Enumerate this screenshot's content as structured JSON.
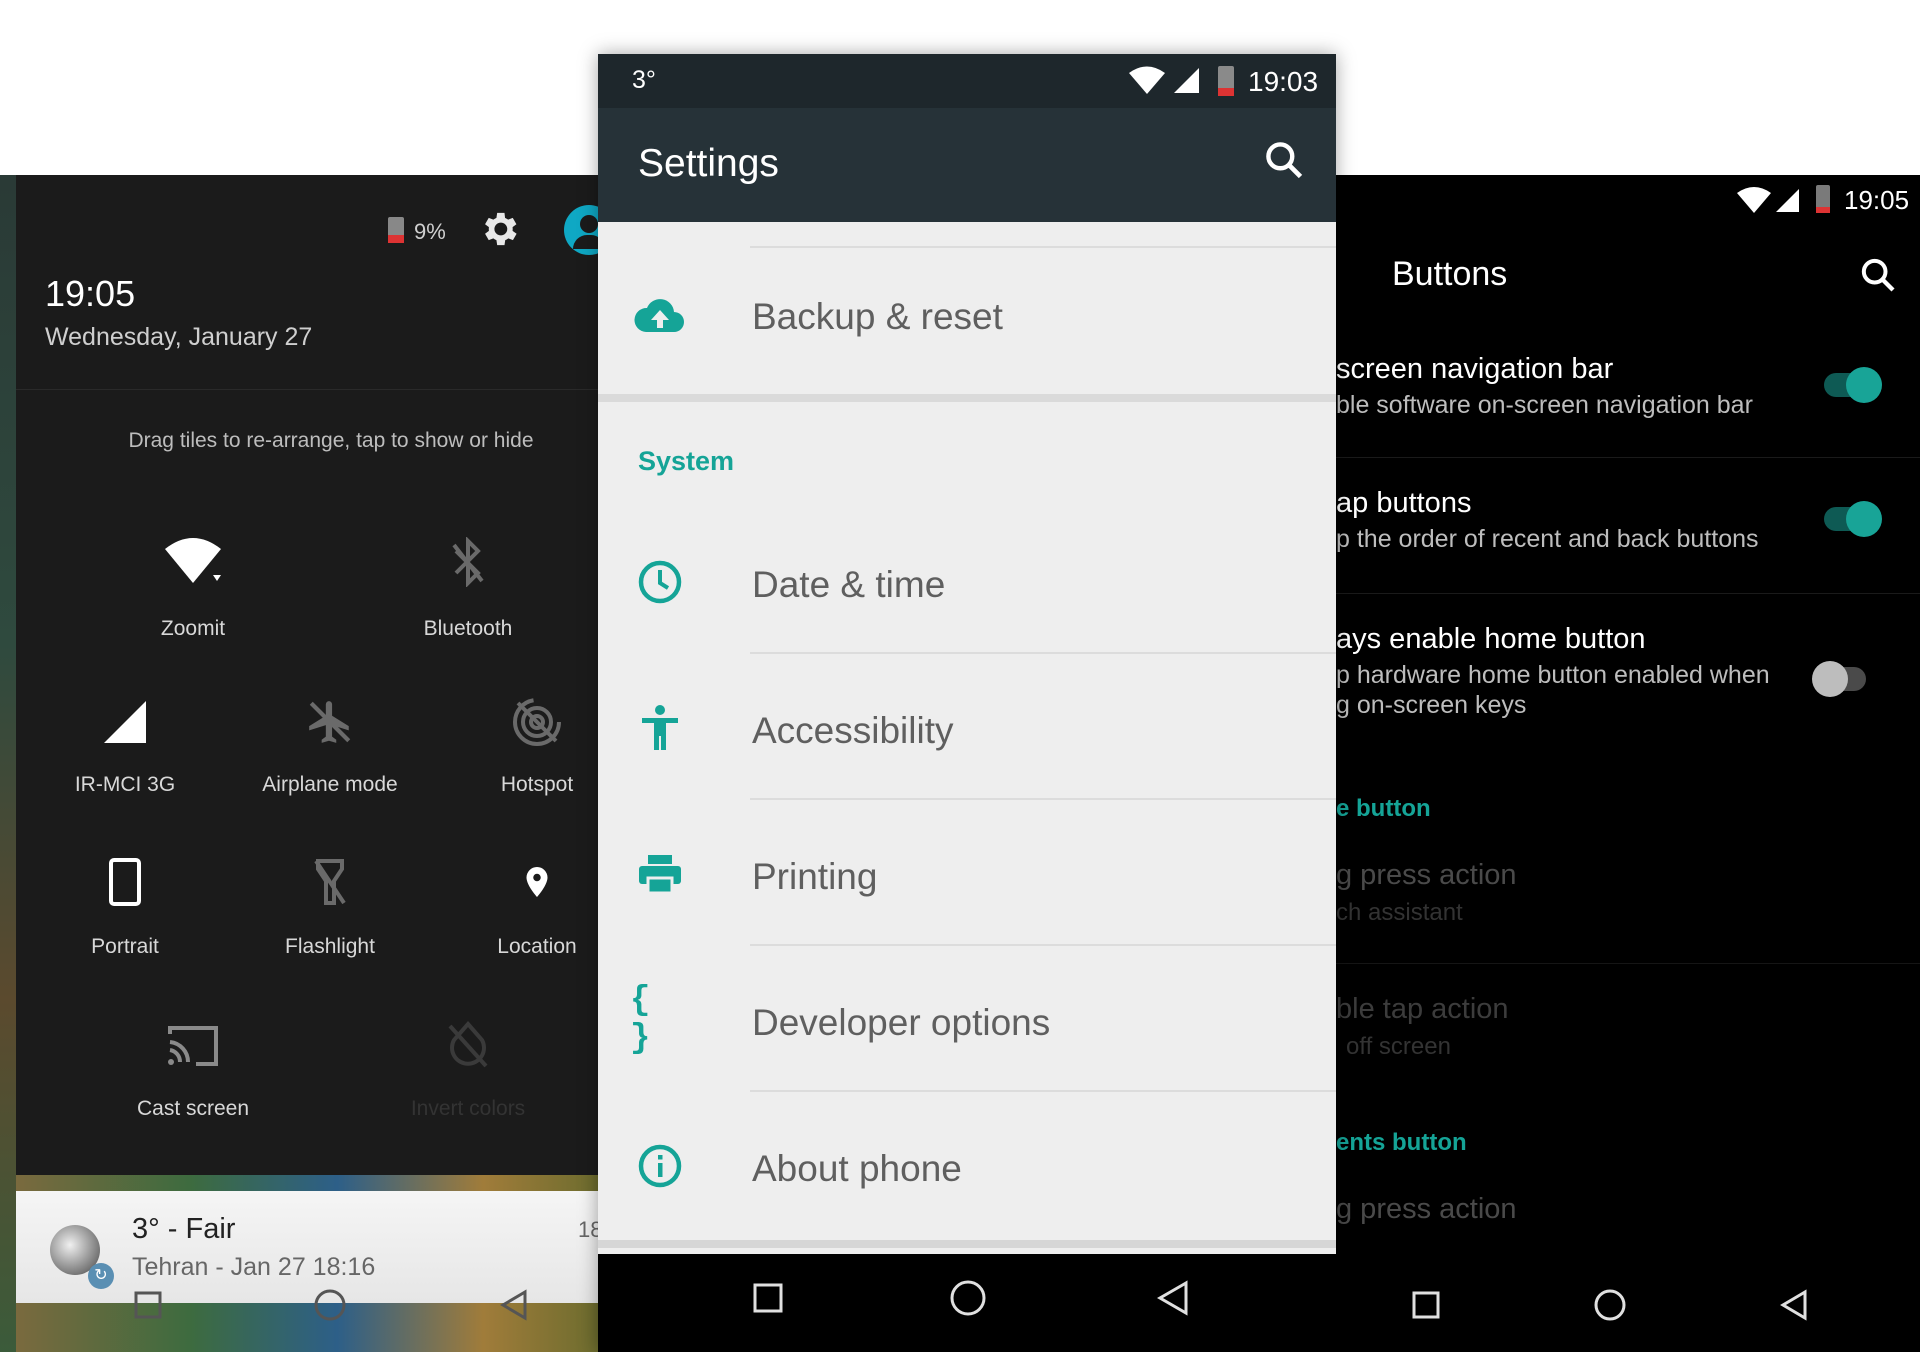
{
  "left": {
    "battery": "9%",
    "time": "19:05",
    "date": "Wednesday, January 27",
    "hint": "Drag tiles to re-arrange, tap to show or hide",
    "tiles": [
      {
        "label": "Zoomit",
        "icon": "wifi-icon",
        "enabled": true
      },
      {
        "label": "Bluetooth",
        "icon": "bluetooth-off-icon",
        "enabled": false
      },
      {
        "label": "IR-MCI 3G",
        "icon": "cell-signal-icon",
        "enabled": true
      },
      {
        "label": "Airplane mode",
        "icon": "airplane-icon",
        "enabled": false
      },
      {
        "label": "Hotspot",
        "icon": "hotspot-icon",
        "enabled": false
      },
      {
        "label": "Portrait",
        "icon": "portrait-icon",
        "enabled": true
      },
      {
        "label": "Flashlight",
        "icon": "flashlight-icon",
        "enabled": false
      },
      {
        "label": "Location",
        "icon": "location-icon",
        "enabled": true
      },
      {
        "label": "Cast screen",
        "icon": "cast-icon",
        "enabled": true
      },
      {
        "label": "Invert colors",
        "icon": "invert-colors-icon",
        "enabled": false
      }
    ],
    "notification": {
      "title": "3° - Fair",
      "subtitle": "Tehran - Jan 27  18:16",
      "right_text": "18"
    }
  },
  "mid": {
    "status_left": "3°",
    "time": "19:03",
    "title": "Settings",
    "rows_top": [
      {
        "label": "Backup & reset",
        "icon": "cloud-upload-icon"
      }
    ],
    "section": "System",
    "rows": [
      {
        "label": "Date & time",
        "icon": "clock-icon"
      },
      {
        "label": "Accessibility",
        "icon": "accessibility-icon"
      },
      {
        "label": "Printing",
        "icon": "printer-icon"
      },
      {
        "label": "Developer options",
        "icon": "braces-icon"
      },
      {
        "label": "About phone",
        "icon": "info-icon"
      }
    ],
    "braces": "{ }"
  },
  "right": {
    "time": "19:05",
    "title": "Buttons",
    "items": [
      {
        "title": "screen navigation bar",
        "sub": "ble software on-screen navigation bar",
        "toggle": true
      },
      {
        "title": "ap buttons",
        "sub": "p the order of recent and back buttons",
        "toggle": true
      },
      {
        "title": "ays enable home button",
        "sub": "p hardware home button enabled when",
        "sub2": "g on-screen keys",
        "toggle": false
      }
    ],
    "section1": "e button",
    "dim_items": [
      {
        "title": "g press action",
        "sub": "ch assistant"
      },
      {
        "title": "ble tap action",
        "sub": "off screen"
      }
    ],
    "section2": "ents button",
    "dim_last": "g press action"
  },
  "colors": {
    "accent": "#15a497",
    "appbar": "#263238",
    "settings_bg": "#eeeeee"
  }
}
